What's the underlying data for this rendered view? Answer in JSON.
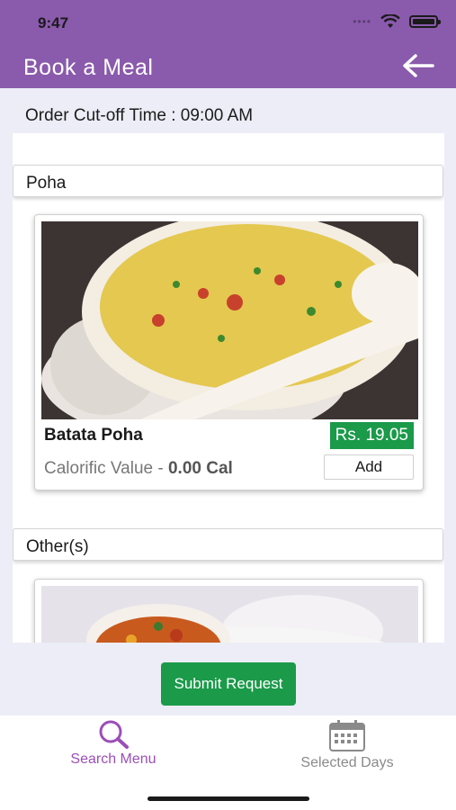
{
  "status_bar": {
    "time": "9:47"
  },
  "header": {
    "title": "Book a Meal"
  },
  "order": {
    "cutoff_text": "Order Cut-off Time : 09:00 AM"
  },
  "sections": [
    {
      "name": "Poha",
      "items": [
        {
          "name": "Batata Poha",
          "price": "Rs. 19.05",
          "cal_label": "Calorific Value - ",
          "cal_value": "0.00 Cal",
          "add_label": "Add"
        }
      ]
    },
    {
      "name": "Other(s)"
    }
  ],
  "submit_label": "Submit Request",
  "tabbar": {
    "search_label": "Search Menu",
    "days_label": "Selected Days"
  },
  "colors": {
    "header": "#8a5aac",
    "accent_green": "#1b9a4a",
    "active_tab": "#9b4fb8"
  }
}
